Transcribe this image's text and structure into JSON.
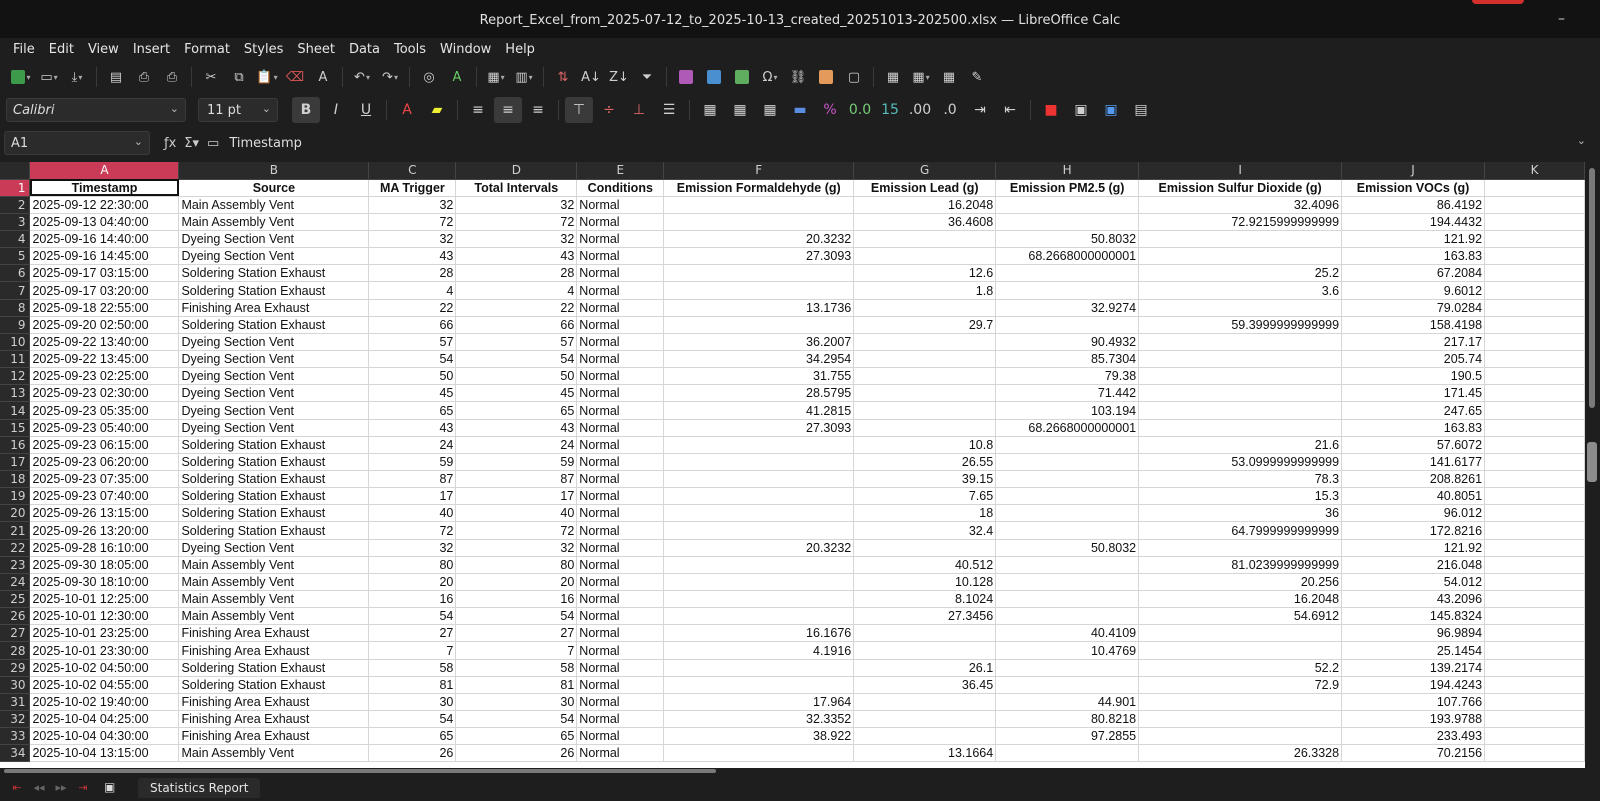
{
  "window": {
    "title": "Report_Excel_from_2025-07-12_to_2025-10-13_created_20251013-202500.xlsx — LibreOffice Calc",
    "minimize_icon": "minimize-icon"
  },
  "menu": [
    "File",
    "Edit",
    "View",
    "Insert",
    "Format",
    "Styles",
    "Sheet",
    "Data",
    "Tools",
    "Window",
    "Help"
  ],
  "format": {
    "font_name": "Calibri",
    "font_size": "11 pt"
  },
  "formula_bar": {
    "cell_ref": "A1",
    "content": "Timestamp"
  },
  "sheet": {
    "columns": [
      "A",
      "B",
      "C",
      "D",
      "E",
      "F",
      "G",
      "H",
      "I",
      "J",
      "K"
    ],
    "headers": [
      "Timestamp",
      "Source",
      "MA Trigger",
      "Total Intervals",
      "Conditions",
      "Emission Formaldehyde (g)",
      "Emission Lead (g)",
      "Emission PM2.5 (g)",
      "Emission Sulfur Dioxide (g)",
      "Emission VOCs (g)",
      ""
    ],
    "rows": [
      [
        "2025-09-12 22:30:00",
        "Main Assembly Vent",
        "32",
        "32",
        "Normal",
        "",
        "16.2048",
        "",
        "32.4096",
        "86.4192"
      ],
      [
        "2025-09-13 04:40:00",
        "Main Assembly Vent",
        "72",
        "72",
        "Normal",
        "",
        "36.4608",
        "",
        "72.9215999999999",
        "194.4432"
      ],
      [
        "2025-09-16 14:40:00",
        "Dyeing Section Vent",
        "32",
        "32",
        "Normal",
        "20.3232",
        "",
        "50.8032",
        "",
        "121.92"
      ],
      [
        "2025-09-16 14:45:00",
        "Dyeing Section Vent",
        "43",
        "43",
        "Normal",
        "27.3093",
        "",
        "68.2668000000001",
        "",
        "163.83"
      ],
      [
        "2025-09-17 03:15:00",
        "Soldering Station Exhaust",
        "28",
        "28",
        "Normal",
        "",
        "12.6",
        "",
        "25.2",
        "67.2084"
      ],
      [
        "2025-09-17 03:20:00",
        "Soldering Station Exhaust",
        "4",
        "4",
        "Normal",
        "",
        "1.8",
        "",
        "3.6",
        "9.6012"
      ],
      [
        "2025-09-18 22:55:00",
        "Finishing Area Exhaust",
        "22",
        "22",
        "Normal",
        "13.1736",
        "",
        "32.9274",
        "",
        "79.0284"
      ],
      [
        "2025-09-20 02:50:00",
        "Soldering Station Exhaust",
        "66",
        "66",
        "Normal",
        "",
        "29.7",
        "",
        "59.3999999999999",
        "158.4198"
      ],
      [
        "2025-09-22 13:40:00",
        "Dyeing Section Vent",
        "57",
        "57",
        "Normal",
        "36.2007",
        "",
        "90.4932",
        "",
        "217.17"
      ],
      [
        "2025-09-22 13:45:00",
        "Dyeing Section Vent",
        "54",
        "54",
        "Normal",
        "34.2954",
        "",
        "85.7304",
        "",
        "205.74"
      ],
      [
        "2025-09-23 02:25:00",
        "Dyeing Section Vent",
        "50",
        "50",
        "Normal",
        "31.755",
        "",
        "79.38",
        "",
        "190.5"
      ],
      [
        "2025-09-23 02:30:00",
        "Dyeing Section Vent",
        "45",
        "45",
        "Normal",
        "28.5795",
        "",
        "71.442",
        "",
        "171.45"
      ],
      [
        "2025-09-23 05:35:00",
        "Dyeing Section Vent",
        "65",
        "65",
        "Normal",
        "41.2815",
        "",
        "103.194",
        "",
        "247.65"
      ],
      [
        "2025-09-23 05:40:00",
        "Dyeing Section Vent",
        "43",
        "43",
        "Normal",
        "27.3093",
        "",
        "68.2668000000001",
        "",
        "163.83"
      ],
      [
        "2025-09-23 06:15:00",
        "Soldering Station Exhaust",
        "24",
        "24",
        "Normal",
        "",
        "10.8",
        "",
        "21.6",
        "57.6072"
      ],
      [
        "2025-09-23 06:20:00",
        "Soldering Station Exhaust",
        "59",
        "59",
        "Normal",
        "",
        "26.55",
        "",
        "53.0999999999999",
        "141.6177"
      ],
      [
        "2025-09-23 07:35:00",
        "Soldering Station Exhaust",
        "87",
        "87",
        "Normal",
        "",
        "39.15",
        "",
        "78.3",
        "208.8261"
      ],
      [
        "2025-09-23 07:40:00",
        "Soldering Station Exhaust",
        "17",
        "17",
        "Normal",
        "",
        "7.65",
        "",
        "15.3",
        "40.8051"
      ],
      [
        "2025-09-26 13:15:00",
        "Soldering Station Exhaust",
        "40",
        "40",
        "Normal",
        "",
        "18",
        "",
        "36",
        "96.012"
      ],
      [
        "2025-09-26 13:20:00",
        "Soldering Station Exhaust",
        "72",
        "72",
        "Normal",
        "",
        "32.4",
        "",
        "64.7999999999999",
        "172.8216"
      ],
      [
        "2025-09-28 16:10:00",
        "Dyeing Section Vent",
        "32",
        "32",
        "Normal",
        "20.3232",
        "",
        "50.8032",
        "",
        "121.92"
      ],
      [
        "2025-09-30 18:05:00",
        "Main Assembly Vent",
        "80",
        "80",
        "Normal",
        "",
        "40.512",
        "",
        "81.0239999999999",
        "216.048"
      ],
      [
        "2025-09-30 18:10:00",
        "Main Assembly Vent",
        "20",
        "20",
        "Normal",
        "",
        "10.128",
        "",
        "20.256",
        "54.012"
      ],
      [
        "2025-10-01 12:25:00",
        "Main Assembly Vent",
        "16",
        "16",
        "Normal",
        "",
        "8.1024",
        "",
        "16.2048",
        "43.2096"
      ],
      [
        "2025-10-01 12:30:00",
        "Main Assembly Vent",
        "54",
        "54",
        "Normal",
        "",
        "27.3456",
        "",
        "54.6912",
        "145.8324"
      ],
      [
        "2025-10-01 23:25:00",
        "Finishing Area Exhaust",
        "27",
        "27",
        "Normal",
        "16.1676",
        "",
        "40.4109",
        "",
        "96.9894"
      ],
      [
        "2025-10-01 23:30:00",
        "Finishing Area Exhaust",
        "7",
        "7",
        "Normal",
        "4.1916",
        "",
        "10.4769",
        "",
        "25.1454"
      ],
      [
        "2025-10-02 04:50:00",
        "Soldering Station Exhaust",
        "58",
        "58",
        "Normal",
        "",
        "26.1",
        "",
        "52.2",
        "139.2174"
      ],
      [
        "2025-10-02 04:55:00",
        "Soldering Station Exhaust",
        "81",
        "81",
        "Normal",
        "",
        "36.45",
        "",
        "72.9",
        "194.4243"
      ],
      [
        "2025-10-02 19:40:00",
        "Finishing Area Exhaust",
        "30",
        "30",
        "Normal",
        "17.964",
        "",
        "44.901",
        "",
        "107.766"
      ],
      [
        "2025-10-04 04:25:00",
        "Finishing Area Exhaust",
        "54",
        "54",
        "Normal",
        "32.3352",
        "",
        "80.8218",
        "",
        "193.9788"
      ],
      [
        "2025-10-04 04:30:00",
        "Finishing Area Exhaust",
        "65",
        "65",
        "Normal",
        "38.922",
        "",
        "97.2855",
        "",
        "233.493"
      ],
      [
        "2025-10-04 13:15:00",
        "Main Assembly Vent",
        "26",
        "26",
        "Normal",
        "",
        "13.1664",
        "",
        "26.3328",
        "70.2156"
      ]
    ]
  },
  "sheet_tabs": [
    "Statistics Report"
  ]
}
